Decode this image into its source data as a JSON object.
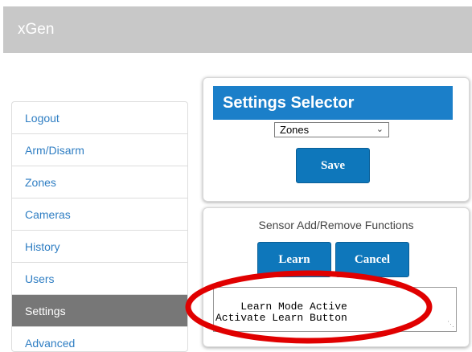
{
  "header": {
    "app_title": "xGen"
  },
  "sidebar": {
    "items": [
      {
        "label": "Logout"
      },
      {
        "label": "Arm/Disarm"
      },
      {
        "label": "Zones"
      },
      {
        "label": "Cameras"
      },
      {
        "label": "History"
      },
      {
        "label": "Users"
      },
      {
        "label": "Settings",
        "active": true
      },
      {
        "label": "Advanced"
      }
    ]
  },
  "settings_selector": {
    "title": "Settings Selector",
    "selected": "Zones",
    "save_label": "Save"
  },
  "sensor_panel": {
    "heading": "Sensor Add/Remove Functions",
    "learn_label": "Learn",
    "cancel_label": "Cancel",
    "status_text": "Learn Mode Active\nActivate Learn Button"
  },
  "colors": {
    "header_bg": "#c8c8c8",
    "accent": "#1b7fc9",
    "button": "#0e77bb",
    "nav_link": "#2f7ec3",
    "nav_active_bg": "#777777",
    "annotation": "#e00000"
  },
  "icons": {
    "select_arrow": "chevron-down-icon",
    "textarea_grip": "resize-grip-icon"
  }
}
